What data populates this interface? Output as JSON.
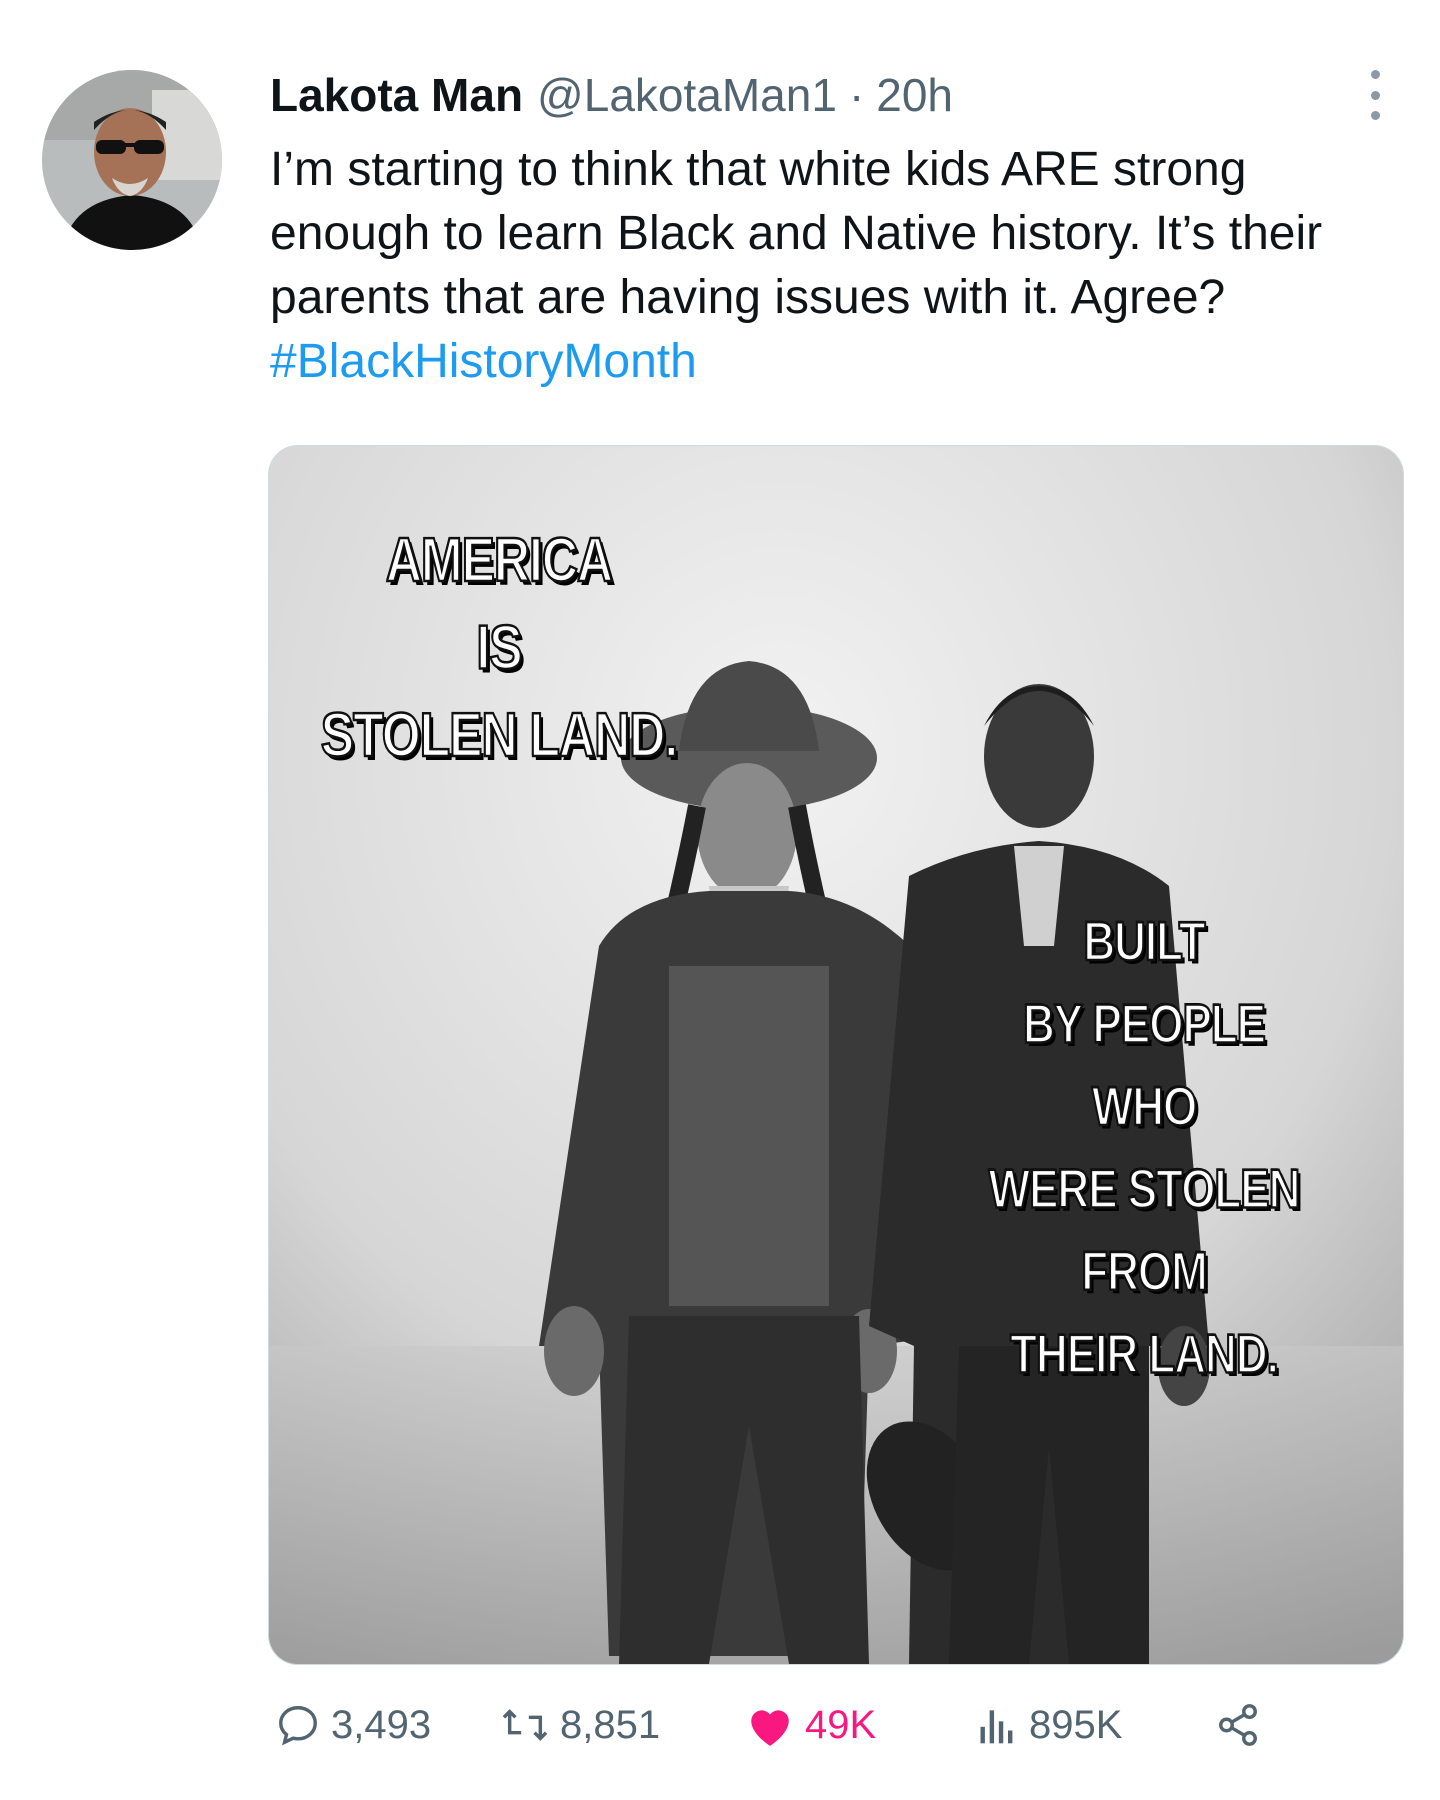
{
  "author": {
    "name": "Lakota Man",
    "handle": "@LakotaMan1",
    "separator": "·",
    "time": "20h"
  },
  "tweet": {
    "text": "I’m starting to think that white kids ARE strong enough to learn Black and Native history. It’s their parents that are having issues with it. Agree? ",
    "hashtag": "#BlackHistoryMonth"
  },
  "media": {
    "caption_left": "AMERICA\nIS\nSTOLEN LAND.",
    "caption_right": "BUILT\nBY PEOPLE\nWHO\nWERE STOLEN\nFROM\nTHEIR LAND."
  },
  "actions": {
    "replies": "3,493",
    "retweets": "8,851",
    "likes": "49K",
    "views": "895K"
  },
  "colors": {
    "text": "#0f1419",
    "secondary": "#536471",
    "link": "#1d9bf0",
    "like": "#f91880"
  },
  "icons": [
    "more-icon",
    "reply-icon",
    "retweet-icon",
    "heart-icon",
    "views-icon",
    "share-icon"
  ]
}
